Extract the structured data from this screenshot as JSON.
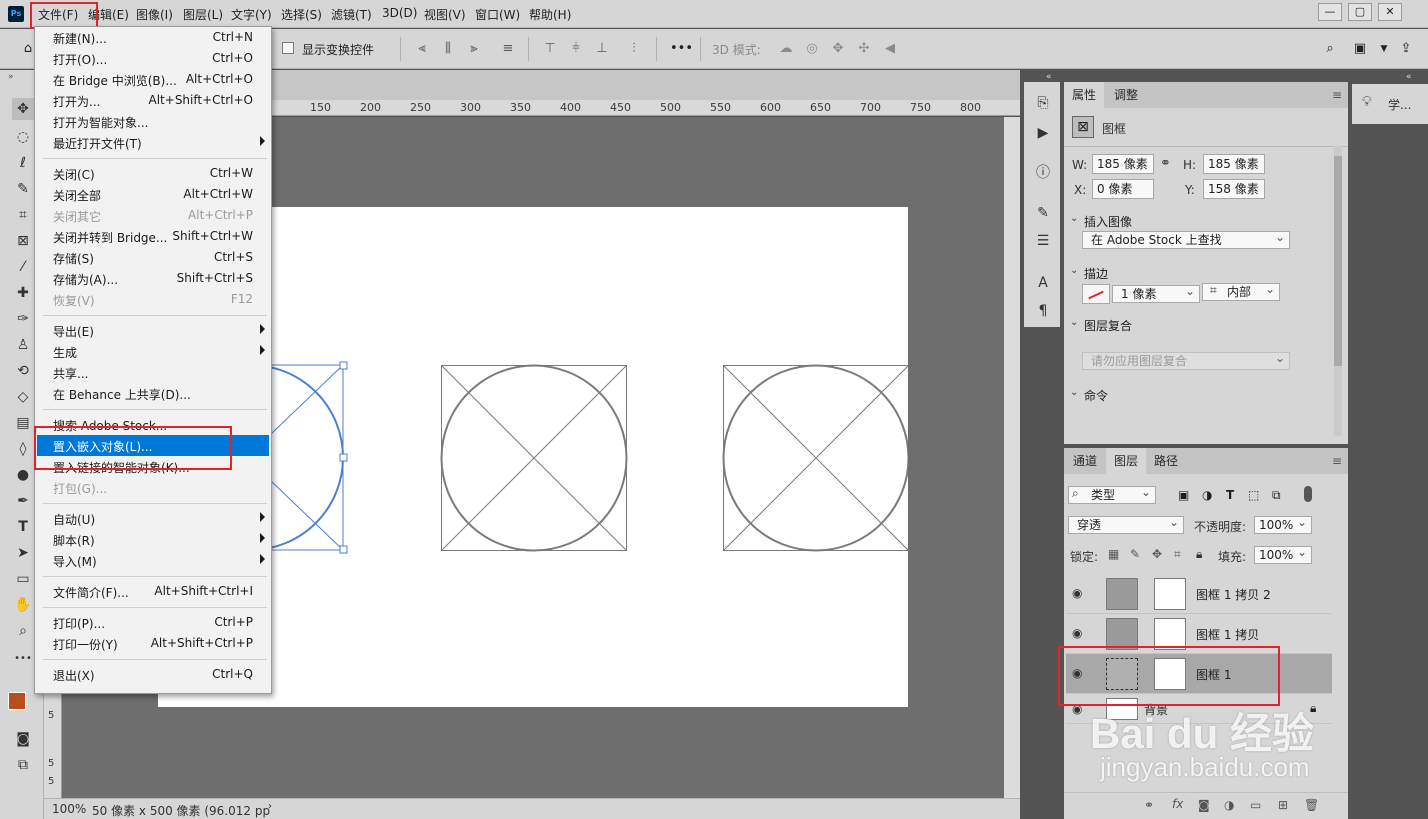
{
  "app": {
    "logo": "Ps"
  },
  "menubar": {
    "items": [
      "文件(F)",
      "编辑(E)",
      "图像(I)",
      "图层(L)",
      "文字(Y)",
      "选择(S)",
      "滤镜(T)",
      "3D(D)",
      "视图(V)",
      "窗口(W)",
      "帮助(H)"
    ],
    "window_buttons": [
      "—",
      "▢",
      "✕"
    ]
  },
  "options": {
    "show_transform_label": "显示变换控件",
    "mode_3d_label": "3D 模式:",
    "more_icon": "•••"
  },
  "ruler": {
    "h_ticks": [
      "150",
      "200",
      "250",
      "300",
      "350",
      "400",
      "450",
      "500",
      "550",
      "600",
      "650",
      "700",
      "750",
      "800"
    ],
    "v_ticks": [
      "5",
      "5",
      "5"
    ]
  },
  "status": {
    "zoom": "100%",
    "info": "50 像素 x 500 像素 (96.012 pp"
  },
  "file_menu": {
    "groups": [
      [
        {
          "label": "新建(N)...",
          "shortcut": "Ctrl+N"
        },
        {
          "label": "打开(O)...",
          "shortcut": "Ctrl+O"
        },
        {
          "label": "在 Bridge 中浏览(B)...",
          "shortcut": "Alt+Ctrl+O"
        },
        {
          "label": "打开为...",
          "shortcut": "Alt+Shift+Ctrl+O"
        },
        {
          "label": "打开为智能对象...",
          "shortcut": ""
        },
        {
          "label": "最近打开文件(T)",
          "shortcut": "",
          "submenu": true
        }
      ],
      [
        {
          "label": "关闭(C)",
          "shortcut": "Ctrl+W"
        },
        {
          "label": "关闭全部",
          "shortcut": "Alt+Ctrl+W"
        },
        {
          "label": "关闭其它",
          "shortcut": "Alt+Ctrl+P",
          "disabled": true
        },
        {
          "label": "关闭并转到 Bridge...",
          "shortcut": "Shift+Ctrl+W"
        },
        {
          "label": "存储(S)",
          "shortcut": "Ctrl+S"
        },
        {
          "label": "存储为(A)...",
          "shortcut": "Shift+Ctrl+S"
        },
        {
          "label": "恢复(V)",
          "shortcut": "F12",
          "disabled": true
        }
      ],
      [
        {
          "label": "导出(E)",
          "shortcut": "",
          "submenu": true
        },
        {
          "label": "生成",
          "shortcut": "",
          "submenu": true
        },
        {
          "label": "共享...",
          "shortcut": ""
        },
        {
          "label": "在 Behance 上共享(D)...",
          "shortcut": ""
        }
      ],
      [
        {
          "label": "搜索 Adobe Stock...",
          "shortcut": ""
        },
        {
          "label": "置入嵌入对象(L)...",
          "shortcut": "",
          "highlighted": true
        },
        {
          "label": "置入链接的智能对象(K)...",
          "shortcut": ""
        },
        {
          "label": "打包(G)...",
          "shortcut": "",
          "disabled": true
        }
      ],
      [
        {
          "label": "自动(U)",
          "shortcut": "",
          "submenu": true
        },
        {
          "label": "脚本(R)",
          "shortcut": "",
          "submenu": true
        },
        {
          "label": "导入(M)",
          "shortcut": "",
          "submenu": true
        }
      ],
      [
        {
          "label": "文件简介(F)...",
          "shortcut": "Alt+Shift+Ctrl+I"
        }
      ],
      [
        {
          "label": "打印(P)...",
          "shortcut": "Ctrl+P"
        },
        {
          "label": "打印一份(Y)",
          "shortcut": "Alt+Shift+Ctrl+P"
        }
      ],
      [
        {
          "label": "退出(X)",
          "shortcut": "Ctrl+Q"
        }
      ]
    ]
  },
  "properties": {
    "tabs": [
      "属性",
      "调整"
    ],
    "type_label": "图框",
    "w_label": "W:",
    "w_value": "185 像素",
    "h_label": "H:",
    "h_value": "185 像素",
    "x_label": "X:",
    "x_value": "0 像素",
    "y_label": "Y:",
    "y_value": "158 像素",
    "insert_image_title": "插入图像",
    "insert_image_select": "在 Adobe Stock 上查找",
    "stroke_title": "描边",
    "stroke_size": "1 像素",
    "stroke_align": "内部",
    "layer_comp_title": "图层复合",
    "layer_comp_select": "请勿应用图层复合",
    "command_title": "命令"
  },
  "layers": {
    "tabs": [
      "通道",
      "图层",
      "路径"
    ],
    "filter_label": "类型",
    "blend_mode": "穿透",
    "opacity_label": "不透明度:",
    "opacity_value": "100%",
    "lock_label": "锁定:",
    "fill_label": "填充:",
    "fill_value": "100%",
    "rows": [
      {
        "name": "图框 1 拷贝 2"
      },
      {
        "name": "图框 1 拷贝"
      },
      {
        "name": "图框 1"
      },
      {
        "name": "背景"
      }
    ],
    "bottom_icons": [
      "GO",
      "fx"
    ]
  },
  "learn": {
    "label": "学..."
  },
  "watermark": {
    "text": "Bai du 经验",
    "url": "jingyan.baidu.com"
  },
  "colors": {
    "highlight_red": "#e2232a",
    "menu_select_blue": "#0078d7",
    "frame_blue": "#4a7fd4"
  }
}
